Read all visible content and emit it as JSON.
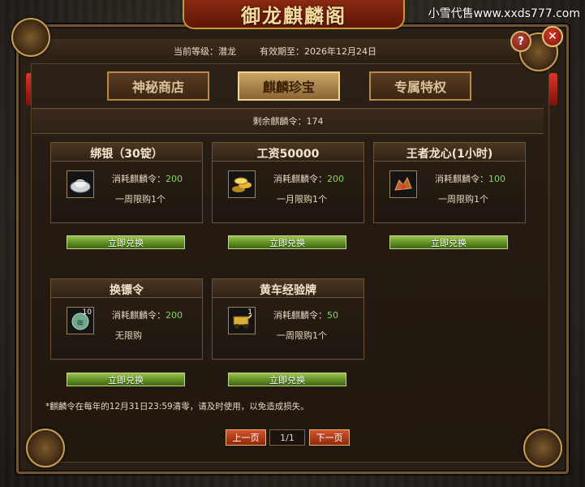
{
  "app": {
    "title": "御龙麒麟阁",
    "watermark": "小雪代售www.xxds777.com"
  },
  "header": {
    "level_text": "当前等级：潜龙",
    "expiry_text": "有效期至：2026年12月24日"
  },
  "tabs": [
    {
      "label": "神秘商店",
      "active": false
    },
    {
      "label": "麒麟珍宝",
      "active": true
    },
    {
      "label": "专属特权",
      "active": false
    }
  ],
  "remaining": {
    "text": "剩余麒麟令：174"
  },
  "items": [
    {
      "title": "绑银（30锭）",
      "cost_label": "消耗麒麟令：",
      "cost": "200",
      "limit": "一周限购1个",
      "icon": "silver-ingot-icon",
      "button": "立即兑换"
    },
    {
      "title": "工资50000",
      "cost_label": "消耗麒麟令：",
      "cost": "200",
      "limit": "一月限购1个",
      "icon": "gold-coins-icon",
      "button": "立即兑换"
    },
    {
      "title": "王者龙心(1小时)",
      "cost_label": "消耗麒麟令：",
      "cost": "100",
      "limit": "一周限购1个",
      "icon": "dragon-heart-icon",
      "button": "立即兑换"
    },
    {
      "title": "换镖令",
      "cost_label": "消耗麒麟令：",
      "cost": "200",
      "limit": "无限购",
      "icon": "escort-token-icon",
      "badge": "10",
      "button": "立即兑换"
    },
    {
      "title": "黄车经验牌",
      "cost_label": "消耗麒麟令：",
      "cost": "50",
      "limit": "一周限购1个",
      "icon": "yellow-cart-plate-icon",
      "badge": "1",
      "button": "立即兑换"
    }
  ],
  "footnote": "*麒麟令在每年的12月31日23:59清零，请及时使用，以免造成损失。",
  "pager": {
    "prev": "上一页",
    "page": "1/1",
    "next": "下一页"
  },
  "colors": {
    "accent_gold": "#c59d55",
    "cost_green": "#87d75a",
    "button_green": "#5a8a20",
    "pager_red": "#d3532a"
  }
}
